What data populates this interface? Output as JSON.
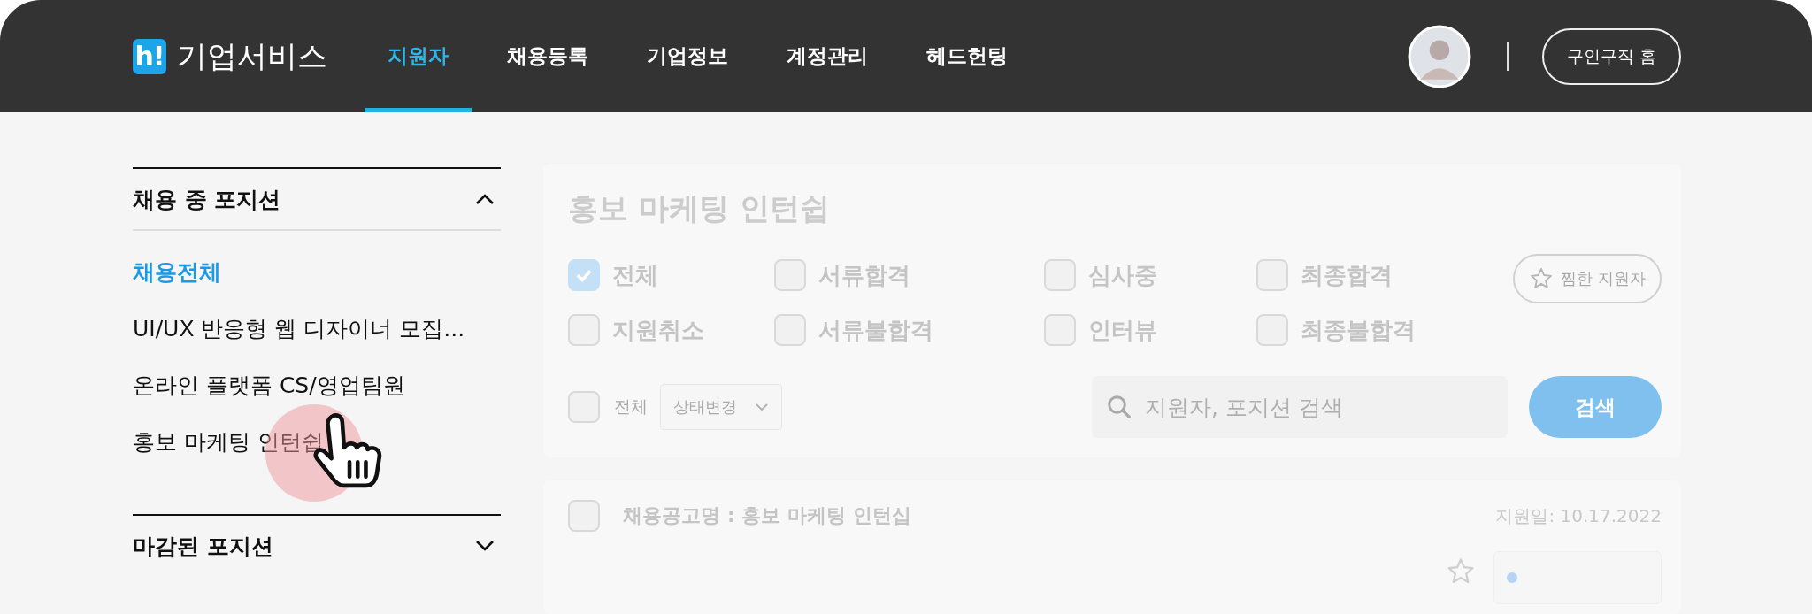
{
  "header": {
    "logo_mark": "h!",
    "logo_text": "기업서비스",
    "nav": [
      {
        "label": "지원자",
        "selected": true
      },
      {
        "label": "채용등록",
        "selected": false
      },
      {
        "label": "기업정보",
        "selected": false
      },
      {
        "label": "계정관리",
        "selected": false
      },
      {
        "label": "헤드헌팅",
        "selected": false
      }
    ],
    "home_button": "구인구직 홈"
  },
  "sidebar": {
    "sections": [
      {
        "title": "채용 중 포지션",
        "expanded": true,
        "items": [
          {
            "label": "채용전체",
            "selected": true
          },
          {
            "label": "UI/UX 반응형 웹 디자이너 모집...",
            "selected": false
          },
          {
            "label": "온라인 플랫폼 CS/영업팀원",
            "selected": false
          },
          {
            "label": "홍보 마케팅 인턴쉽",
            "selected": false
          }
        ]
      },
      {
        "title": "마감된 포지션",
        "expanded": false
      }
    ]
  },
  "panel": {
    "title": "홍보 마케팅 인턴쉽",
    "filters": [
      {
        "label": "전체",
        "checked": true
      },
      {
        "label": "서류합격",
        "checked": false
      },
      {
        "label": "심사중",
        "checked": false
      },
      {
        "label": "최종합격",
        "checked": false
      },
      {
        "label": "지원취소",
        "checked": false
      },
      {
        "label": "서류불합격",
        "checked": false
      },
      {
        "label": "인터뷰",
        "checked": false
      },
      {
        "label": "최종불합격",
        "checked": false
      }
    ],
    "favorites_button": "찜한 지원자",
    "select_all": {
      "label": "전체",
      "checked": false
    },
    "status_dropdown": "상태변경",
    "search": {
      "placeholder": "지원자, 포지션 검색"
    },
    "search_button": "검색"
  },
  "application": {
    "checked": false,
    "job_title": "채용공고명 : 홍보 마케팅 인턴십",
    "date": "지원일: 10.17.2022"
  }
}
